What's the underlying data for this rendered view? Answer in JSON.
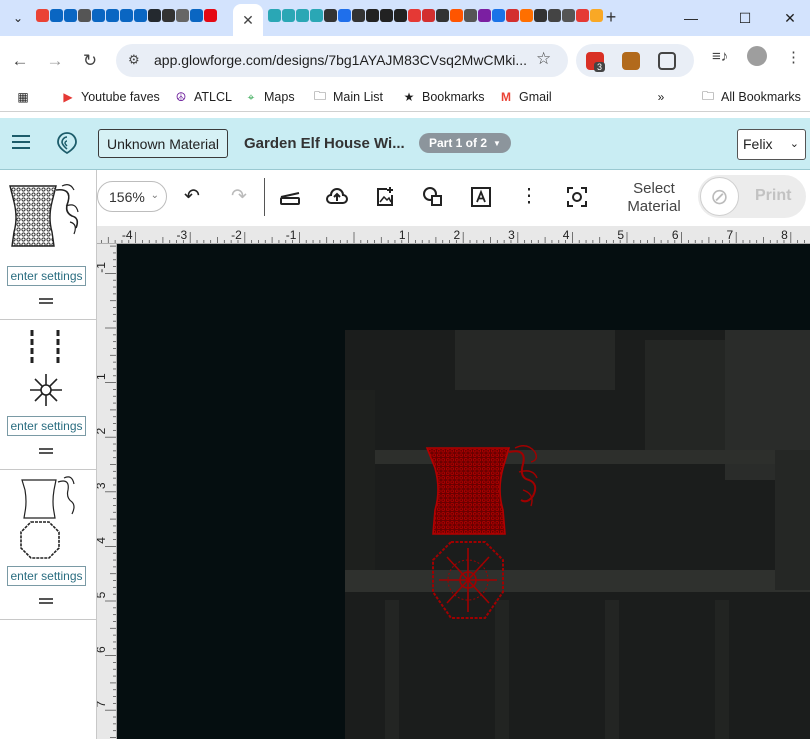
{
  "browser": {
    "url": "app.glowforge.com/designs/7bg1AYAJM83CVsq2MwCMki...",
    "ext_badge": "3",
    "bookmarks": [
      {
        "label": "Youtube faves",
        "icon": "youtube-icon"
      },
      {
        "label": "ATLCL",
        "icon": "peace-icon"
      },
      {
        "label": "Maps",
        "icon": "maps-pin-icon"
      },
      {
        "label": "Main List",
        "icon": "folder-icon"
      },
      {
        "label": "Bookmarks",
        "icon": "star-icon"
      },
      {
        "label": "Gmail",
        "icon": "gmail-icon"
      }
    ],
    "all_bookmarks_label": "All Bookmarks"
  },
  "app": {
    "material_button": "Unknown Material",
    "design_title": "Garden Elf House Wi...",
    "part_label": "Part 1 of 2",
    "user_name": "Felix"
  },
  "left_panel": {
    "cards": [
      {
        "settings_label": "enter settings"
      },
      {
        "settings_label": "enter settings"
      },
      {
        "settings_label": "enter settings"
      }
    ]
  },
  "toolbar": {
    "zoom_value": "156%",
    "select_material_label": "Select Material",
    "print_label": "Print"
  },
  "rulers": {
    "top_labels": [
      "-4",
      "-3",
      "-2",
      "-1",
      "1",
      "2",
      "3",
      "4",
      "5",
      "6",
      "7",
      "8"
    ],
    "left_labels": [
      "-1",
      "1",
      "2",
      "3",
      "4",
      "5",
      "6",
      "7"
    ]
  },
  "colors": {
    "header_bg": "#c9edf3",
    "canvas_bg": "#050e10",
    "design_red": "#9a0000"
  }
}
